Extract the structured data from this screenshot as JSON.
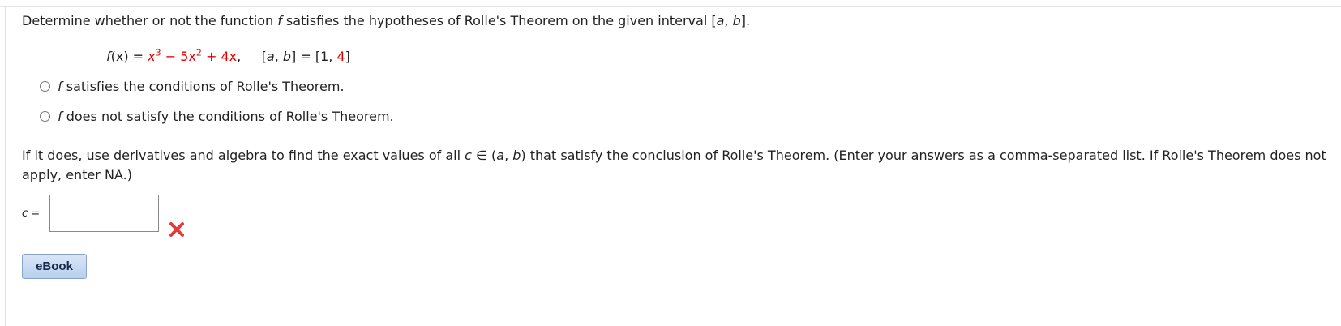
{
  "question": {
    "intro_main": "Determine whether or not the function ",
    "intro_f": "f",
    "intro_rest": " satisfies the hypotheses of Rolle's Theorem on the given interval [",
    "intro_a": "a",
    "intro_comma": ", ",
    "intro_b": "b",
    "intro_end": "].",
    "equation": {
      "lhs_f": "f",
      "lhs_x": "(x) = ",
      "t1": "x",
      "t1_exp": "3",
      "t2": " − 5x",
      "t2_exp": "2",
      "t3": " + 4x",
      "sep": ",     [",
      "a": "a",
      "comma": ", ",
      "b": "b",
      "interval_mid": "] = [1, ",
      "interval_end_val": "4",
      "interval_close": "]"
    }
  },
  "options": [
    {
      "italic": "f",
      "label": " satisfies the conditions of Rolle's Theorem."
    },
    {
      "italic": "f",
      "label": " does not satisfy the conditions of Rolle's Theorem."
    }
  ],
  "followup": {
    "p1": "If it does, use derivatives and algebra to find the exact values of all ",
    "c": "c",
    "in": " ∈ (",
    "a": "a",
    "comma": ", ",
    "b": "b",
    "p2": ") that satisfy the conclusion of Rolle's Theorem. (Enter your answers as a comma-separated list. If Rolle's Theorem does not apply, enter NA.)"
  },
  "answer": {
    "c_label": "c",
    "equals": " =",
    "value": ""
  },
  "buttons": {
    "ebook": "eBook"
  },
  "colors": {
    "highlight": "#e00000",
    "incorrect_mark": "#e23b3b"
  }
}
